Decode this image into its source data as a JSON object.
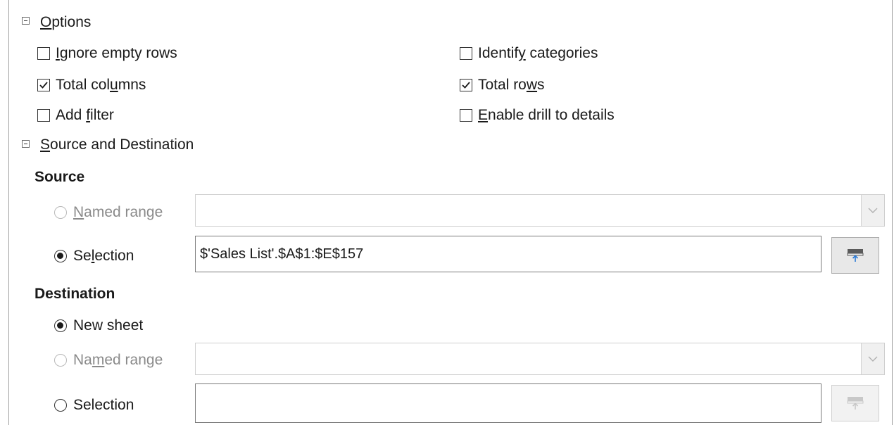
{
  "options": {
    "header": "Options",
    "checkboxes": [
      {
        "label": "Ignore empty rows",
        "checked": false
      },
      {
        "label": "Identify categories",
        "checked": false
      },
      {
        "label": "Total columns",
        "checked": true
      },
      {
        "label": "Total rows",
        "checked": true
      },
      {
        "label": "Add filter",
        "checked": false
      },
      {
        "label": "Enable drill to details",
        "checked": false
      }
    ]
  },
  "source_dest": {
    "header": "Source and Destination",
    "source": {
      "title": "Source",
      "named_range_label": "Named range",
      "named_range_value": "",
      "selection_label": "Selection",
      "selection_value": "$'Sales List'.$A$1:$E$157",
      "selected": "selection"
    },
    "destination": {
      "title": "Destination",
      "new_sheet_label": "New sheet",
      "named_range_label": "Named range",
      "named_range_value": "",
      "selection_label": "Selection",
      "selection_value": "",
      "selected": "new_sheet"
    }
  },
  "icons": {
    "collapse": "collapse-icon",
    "dropdown": "chevron-down-icon",
    "shrink": "shrink-dialog-icon"
  }
}
